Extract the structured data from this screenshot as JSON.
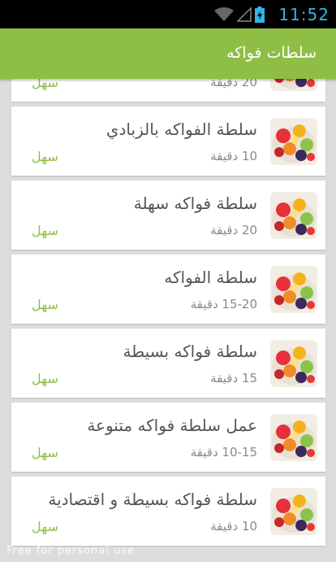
{
  "status_bar": {
    "time": "11:52"
  },
  "app_bar": {
    "title": "سلطات فواكه"
  },
  "recipes": [
    {
      "title": "",
      "time": "20 دقيقة",
      "level": "سهل",
      "thumb": "fruit-salad-bowl-image"
    },
    {
      "title": "سلطة الفواكه بالزبادي",
      "time": "10 دقيقة",
      "level": "سهل",
      "thumb": "fruit-yogurt-image"
    },
    {
      "title": "سلطة فواكه سهلة",
      "time": "20 دقيقة",
      "level": "سهل",
      "thumb": "fruit-salad-bowl-image"
    },
    {
      "title": "سلطة الفواكه",
      "time": "15-20 دقيقة",
      "level": "سهل",
      "thumb": "fruit-salad-bowl-image"
    },
    {
      "title": "سلطة فواكه بسيطة",
      "time": "15 دقيقة",
      "level": "سهل",
      "thumb": "fruit-salad-bowl-image"
    },
    {
      "title": "عمل سلطة فواكه متنوعة",
      "time": "10-15 دقيقة",
      "level": "سهل",
      "thumb": "fruit-salad-bowl-image"
    },
    {
      "title": "سلطة فواكه بسيطة و اقتصادية",
      "time": "10 دقيقة",
      "level": "سهل",
      "thumb": "fruit-salad-bowl-image"
    }
  ],
  "watermark": "Free for personal use",
  "colors": {
    "accent": "#8fbe44",
    "status_blue": "#33b5e5"
  }
}
